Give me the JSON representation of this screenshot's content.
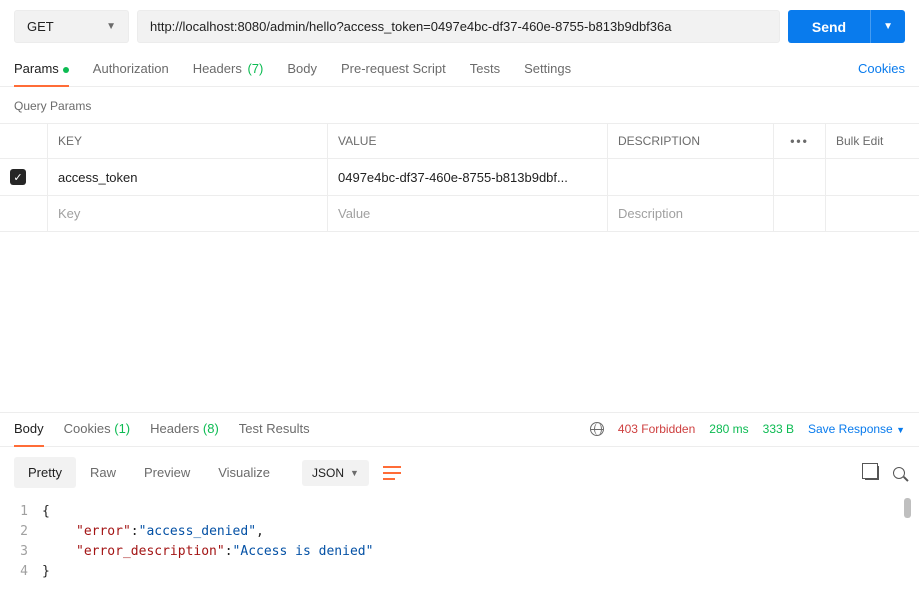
{
  "request": {
    "method": "GET",
    "url": "http://localhost:8080/admin/hello?access_token=0497e4bc-df37-460e-8755-b813b9dbf36a",
    "send_label": "Send"
  },
  "req_tabs": {
    "params": "Params",
    "authorization": "Authorization",
    "headers": "Headers",
    "headers_count": "(7)",
    "body": "Body",
    "prerequest": "Pre-request Script",
    "tests": "Tests",
    "settings": "Settings",
    "cookies_link": "Cookies"
  },
  "query_params": {
    "heading": "Query Params",
    "columns": {
      "key": "KEY",
      "value": "VALUE",
      "description": "DESCRIPTION",
      "more": "•••",
      "bulk": "Bulk Edit"
    },
    "row1": {
      "key": "access_token",
      "value": "0497e4bc-df37-460e-8755-b813b9dbf..."
    },
    "placeholders": {
      "key": "Key",
      "value": "Value",
      "description": "Description"
    }
  },
  "resp_tabs": {
    "body": "Body",
    "cookies": "Cookies",
    "cookies_count": "(1)",
    "headers": "Headers",
    "headers_count": "(8)",
    "tests": "Test Results"
  },
  "resp_meta": {
    "status": "403 Forbidden",
    "time": "280 ms",
    "size": "333 B",
    "save": "Save Response"
  },
  "view_tabs": {
    "pretty": "Pretty",
    "raw": "Raw",
    "preview": "Preview",
    "visualize": "Visualize",
    "format": "JSON"
  },
  "json_body": {
    "l1": "{",
    "l2_key": "\"error\"",
    "l2_colon": ": ",
    "l2_val": "\"access_denied\"",
    "l2_comma": ",",
    "l3_key": "\"error_description\"",
    "l3_colon": ": ",
    "l3_val": "\"Access is denied\"",
    "l4": "}",
    "n1": "1",
    "n2": "2",
    "n3": "3",
    "n4": "4"
  }
}
